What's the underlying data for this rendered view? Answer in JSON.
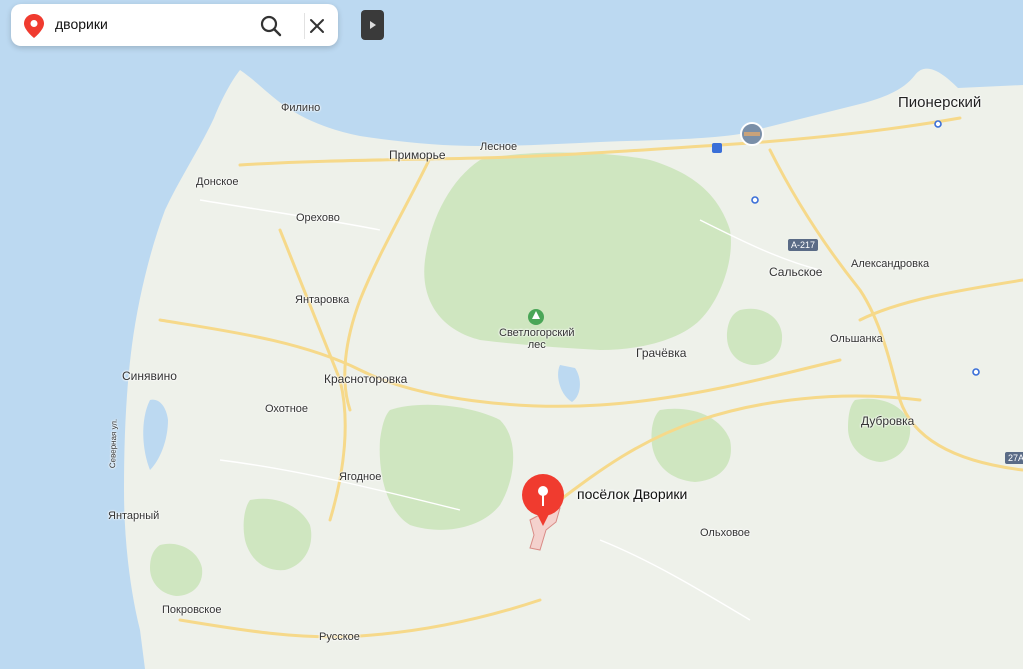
{
  "search": {
    "query": "дворики",
    "pin_icon": "map-pin-icon",
    "search_icon": "magnifier-icon",
    "clear_icon": "close-icon"
  },
  "panel_toggle": {
    "icon": "play-triangle-icon"
  },
  "marker": {
    "label": "посёлок Дворики",
    "color": "#f03b2f",
    "icon": "location-pin-icon"
  },
  "places": {
    "pionersky": "Пионерский",
    "filino": "Филино",
    "primorye": "Приморье",
    "lesnoe": "Лесное",
    "donskoe": "Донское",
    "orekhovo": "Орехово",
    "yantarovka": "Янтаровка",
    "svetlogorsky_les": "Светлогорский\nлес",
    "grachevka": "Грачёвка",
    "salskoe": "Сальское",
    "aleksandrovka": "Александровка",
    "olshanka": "Ольшанка",
    "sinyavino": "Синявино",
    "krasnotorovka": "Красноторовка",
    "okhotnoe": "Охотное",
    "dubrovka": "Дубровка",
    "yagodnoe": "Ягодное",
    "yantarny": "Янтарный",
    "olkhovoe": "Ольховое",
    "pokrovskoe": "Покровское",
    "russkoe": "Русское",
    "severnaya_ul": "Северная ул."
  },
  "roads": {
    "a217": "А-217",
    "r27a": "27А"
  },
  "colors": {
    "sea": "#bcd9f1",
    "land": "#eef1ea",
    "forest": "#cfe6c0",
    "road": "#f6d98a",
    "marker_red": "#f03b2f"
  }
}
